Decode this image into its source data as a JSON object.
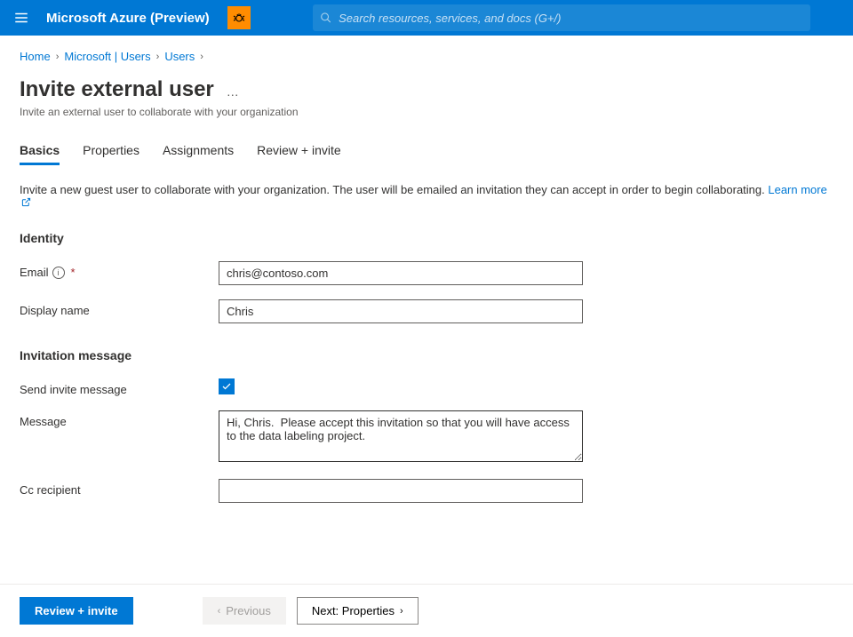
{
  "topbar": {
    "brand": "Microsoft Azure (Preview)",
    "search_placeholder": "Search resources, services, and docs (G+/)"
  },
  "breadcrumb": {
    "items": [
      "Home",
      "Microsoft | Users",
      "Users"
    ]
  },
  "page": {
    "title": "Invite external user",
    "subtitle": "Invite an external user to collaborate with your organization"
  },
  "tabs": [
    {
      "label": "Basics",
      "active": true
    },
    {
      "label": "Properties",
      "active": false
    },
    {
      "label": "Assignments",
      "active": false
    },
    {
      "label": "Review + invite",
      "active": false
    }
  ],
  "intro": {
    "text": "Invite a new guest user to collaborate with your organization. The user will be emailed an invitation they can accept in order to begin collaborating. ",
    "link": "Learn more"
  },
  "sections": {
    "identity_heading": "Identity",
    "invitation_heading": "Invitation message"
  },
  "form": {
    "email_label": "Email",
    "email_value": "chris@contoso.com",
    "display_name_label": "Display name",
    "display_name_value": "Chris",
    "send_invite_label": "Send invite message",
    "send_invite_checked": true,
    "message_label": "Message",
    "message_value": "Hi, Chris.  Please accept this invitation so that you will have access to the data labeling project.",
    "cc_label": "Cc recipient",
    "cc_value": ""
  },
  "footer": {
    "review": "Review + invite",
    "previous": "Previous",
    "next": "Next: Properties"
  }
}
